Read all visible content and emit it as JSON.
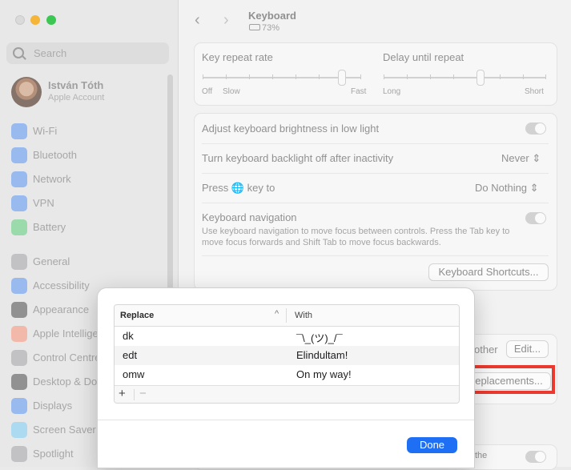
{
  "sidebar": {
    "search_placeholder": "Search",
    "account": {
      "name": "István Tóth",
      "subtitle": "Apple Account"
    },
    "items": [
      {
        "label": "Wi-Fi",
        "icon": "wifi-icon",
        "color": "#2f7cf6"
      },
      {
        "label": "Bluetooth",
        "icon": "bluetooth-icon",
        "color": "#2f7cf6"
      },
      {
        "label": "Network",
        "icon": "globe-icon",
        "color": "#2f7cf6"
      },
      {
        "label": "VPN",
        "icon": "vpn-icon",
        "color": "#2f7cf6"
      },
      {
        "label": "Battery",
        "icon": "battery-icon",
        "color": "#34c759"
      },
      {
        "label": "General",
        "icon": "gear-icon",
        "color": "#8e8e93"
      },
      {
        "label": "Accessibility",
        "icon": "accessibility-icon",
        "color": "#2f7cf6"
      },
      {
        "label": "Appearance",
        "icon": "appearance-icon",
        "color": "#1d1d1f"
      },
      {
        "label": "Apple Intellige",
        "icon": "apple-intelligence-icon",
        "color": "#ff7a59"
      },
      {
        "label": "Control Centre",
        "icon": "control-centre-icon",
        "color": "#8e8e93"
      },
      {
        "label": "Desktop & Do",
        "icon": "desktop-dock-icon",
        "color": "#1d1d1f"
      },
      {
        "label": "Displays",
        "icon": "displays-icon",
        "color": "#2f7cf6"
      },
      {
        "label": "Screen Saver",
        "icon": "screen-saver-icon",
        "color": "#5ac8fa"
      },
      {
        "label": "Spotlight",
        "icon": "spotlight-icon",
        "color": "#8e8e93"
      }
    ]
  },
  "header": {
    "back": "‹",
    "forward": "›",
    "title": "Keyboard",
    "battery": "73%"
  },
  "settings": {
    "key_repeat_rate": "Key repeat rate",
    "delay_until_repeat": "Delay until repeat",
    "off": "Off",
    "slow": "Slow",
    "fast": "Fast",
    "long": "Long",
    "short": "Short",
    "adjust_brightness": "Adjust keyboard brightness in low light",
    "backlight_off": "Turn keyboard backlight off after inactivity",
    "backlight_value": "Never",
    "press_globe": "Press",
    "key_to": "key to",
    "press_value": "Do Nothing",
    "keyboard_nav": "Keyboard navigation",
    "keyboard_nav_desc": "Use keyboard navigation to move focus between controls. Press the Tab key to move focus forwards and Shift Tab to move focus backwards.",
    "keyboard_shortcuts_btn": "Keyboard Shortcuts...",
    "other_text": "other",
    "edit_btn": "Edit...",
    "replacements_btn": "eplacements...",
    "bottom_text": "the"
  },
  "dialog": {
    "col_replace": "Replace",
    "col_with": "With",
    "sort_indicator": "^",
    "rows": [
      {
        "replace": "dk",
        "with": "¯\\_(ツ)_/¯"
      },
      {
        "replace": "edt",
        "with": "Elindultam!"
      },
      {
        "replace": "omw",
        "with": "On my way!"
      }
    ],
    "add": "+",
    "remove": "−",
    "done": "Done"
  }
}
